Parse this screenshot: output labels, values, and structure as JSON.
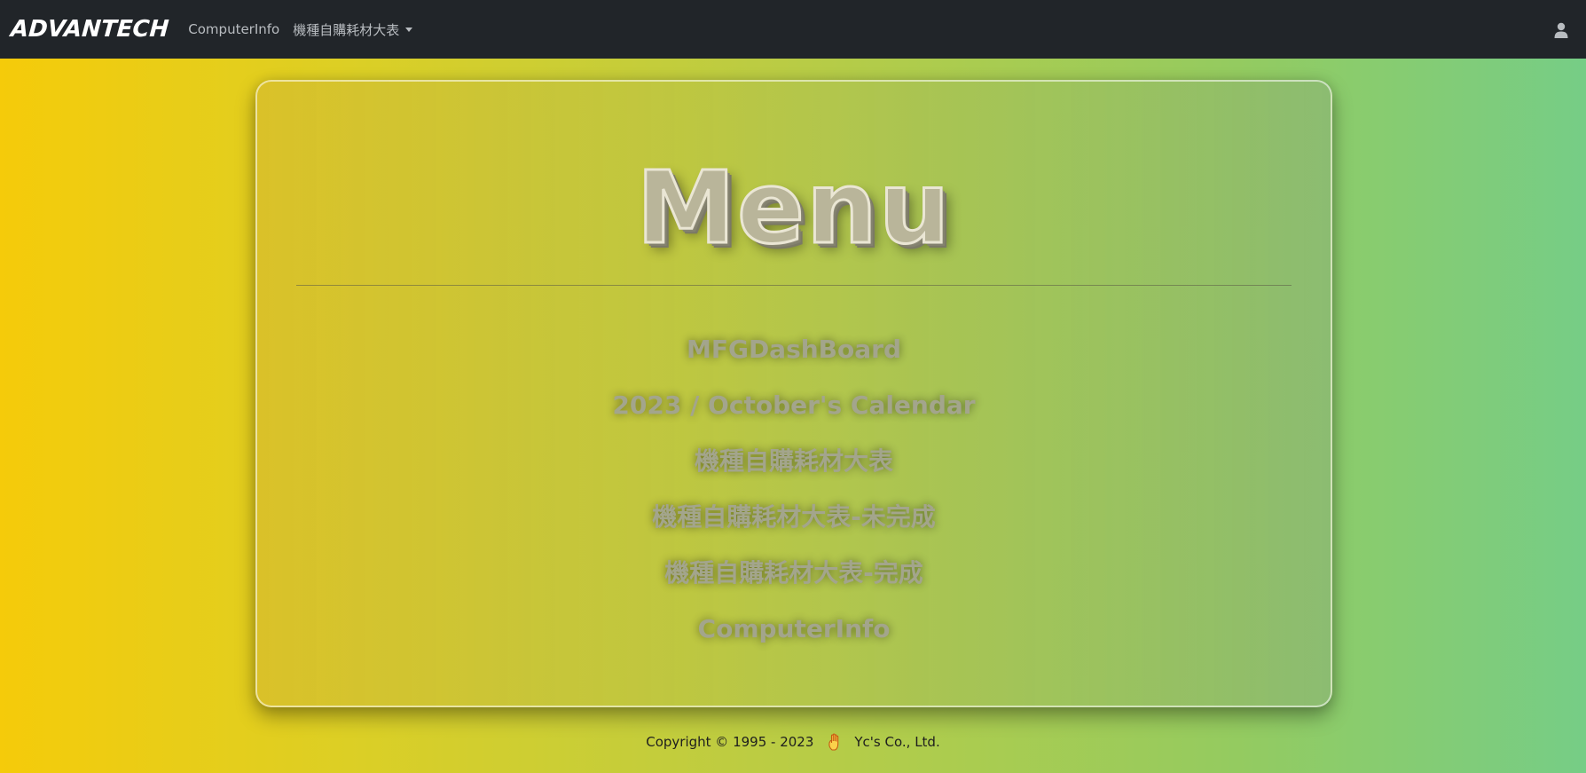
{
  "navbar": {
    "brand": "ADVANTECH",
    "links": [
      {
        "label": "ComputerInfo"
      },
      {
        "label": "機種自購耗材大表"
      }
    ],
    "user_icon": "user-icon"
  },
  "card": {
    "title": "Menu",
    "items": [
      {
        "label": "MFGDashBoard"
      },
      {
        "label": "2023 / October's Calendar"
      },
      {
        "label": "機種自購耗材大表"
      },
      {
        "label": "機種自購耗材大表-未完成"
      },
      {
        "label": "機種自購耗材大表-完成"
      },
      {
        "label": "ComputerInfo"
      }
    ]
  },
  "footer": {
    "copyright": "Copyright © 1995 - 2023",
    "icon": "hand-icon",
    "company": "Yc's Co., Ltd."
  }
}
